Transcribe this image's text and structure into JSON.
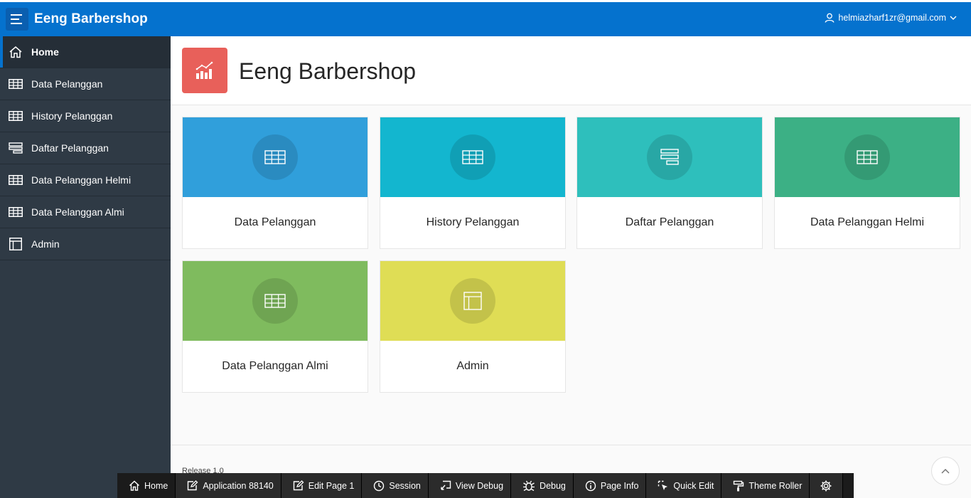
{
  "header": {
    "app_title": "Eeng Barbershop",
    "user_email": "helmiazharf1zr@gmail.com",
    "brand_color": "#0572ce"
  },
  "sidebar": {
    "items": [
      {
        "label": "Home",
        "icon": "home-icon",
        "active": true
      },
      {
        "label": "Data Pelanggan",
        "icon": "table-icon"
      },
      {
        "label": "History Pelanggan",
        "icon": "table-icon"
      },
      {
        "label": "Daftar Pelanggan",
        "icon": "list-icon"
      },
      {
        "label": "Data Pelanggan Helmi",
        "icon": "table-icon"
      },
      {
        "label": "Data Pelanggan Almi",
        "icon": "table-icon"
      },
      {
        "label": "Admin",
        "icon": "layout-icon"
      }
    ]
  },
  "hero": {
    "title": "Eeng Barbershop",
    "icon": "chart-icon",
    "icon_color": "#e8605a"
  },
  "cards": [
    {
      "label": "Data Pelanggan",
      "icon": "table-icon",
      "color": "#309fdb"
    },
    {
      "label": "History Pelanggan",
      "icon": "table-icon",
      "color": "#13b6cf"
    },
    {
      "label": "Daftar Pelanggan",
      "icon": "list-icon",
      "color": "#2ebfbc"
    },
    {
      "label": "Data Pelanggan Helmi",
      "icon": "table-icon",
      "color": "#3cb085"
    },
    {
      "label": "Data Pelanggan Almi",
      "icon": "table-icon",
      "color": "#7fbb5e"
    },
    {
      "label": "Admin",
      "icon": "layout-icon",
      "color": "#dfdd55"
    }
  ],
  "footer": {
    "release": "Release 1.0"
  },
  "devbar": {
    "items": [
      {
        "label": "Home",
        "icon": "home-icon"
      },
      {
        "label": "Application 88140",
        "icon": "edit-icon"
      },
      {
        "label": "Edit Page 1",
        "icon": "pencil-icon"
      },
      {
        "label": "Session",
        "icon": "clock-icon"
      },
      {
        "label": "View Debug",
        "icon": "debug-view-icon"
      },
      {
        "label": "Debug",
        "icon": "bug-icon"
      },
      {
        "label": "Page Info",
        "icon": "info-icon"
      },
      {
        "label": "Quick Edit",
        "icon": "cursor-icon"
      },
      {
        "label": "Theme Roller",
        "icon": "paint-roller-icon"
      },
      {
        "label": "",
        "icon": "gear-icon"
      }
    ]
  }
}
